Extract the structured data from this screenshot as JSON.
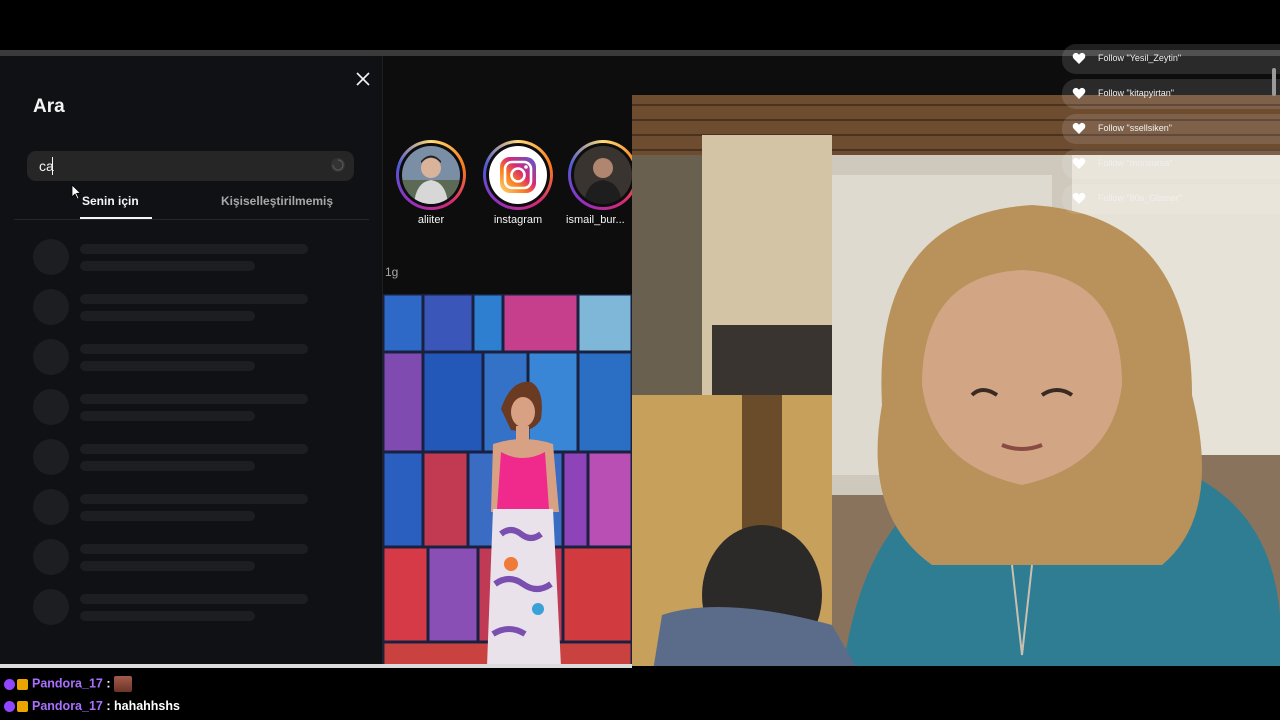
{
  "search_panel": {
    "title": "Ara",
    "search_value": "ca",
    "tabs": [
      {
        "label": "Senin için",
        "active": true
      },
      {
        "label": "Kişiselleştirilmemiş",
        "active": false
      }
    ]
  },
  "stories": [
    {
      "name": "aliiter"
    },
    {
      "name": "instagram"
    },
    {
      "name": "ismail_bur..."
    }
  ],
  "feed": {
    "time_label": "1g"
  },
  "notifications": [
    {
      "text": "Follow \"Yesil_Zeytin\""
    },
    {
      "text": "Follow \"kitapyirtan\""
    },
    {
      "text": "Follow \"ssellsiken\""
    },
    {
      "text": "Follow \"monsursa\""
    },
    {
      "text": "Follow \"80s_Glamer\""
    }
  ],
  "chat": [
    {
      "user": "Pandora_17",
      "message": ""
    },
    {
      "user": "Pandora_17",
      "message": "hahahhshs"
    }
  ],
  "colors": {
    "accent_instagram": "#d62976",
    "chat_user": "#a970ff",
    "panel_bg": "#0f1114"
  }
}
